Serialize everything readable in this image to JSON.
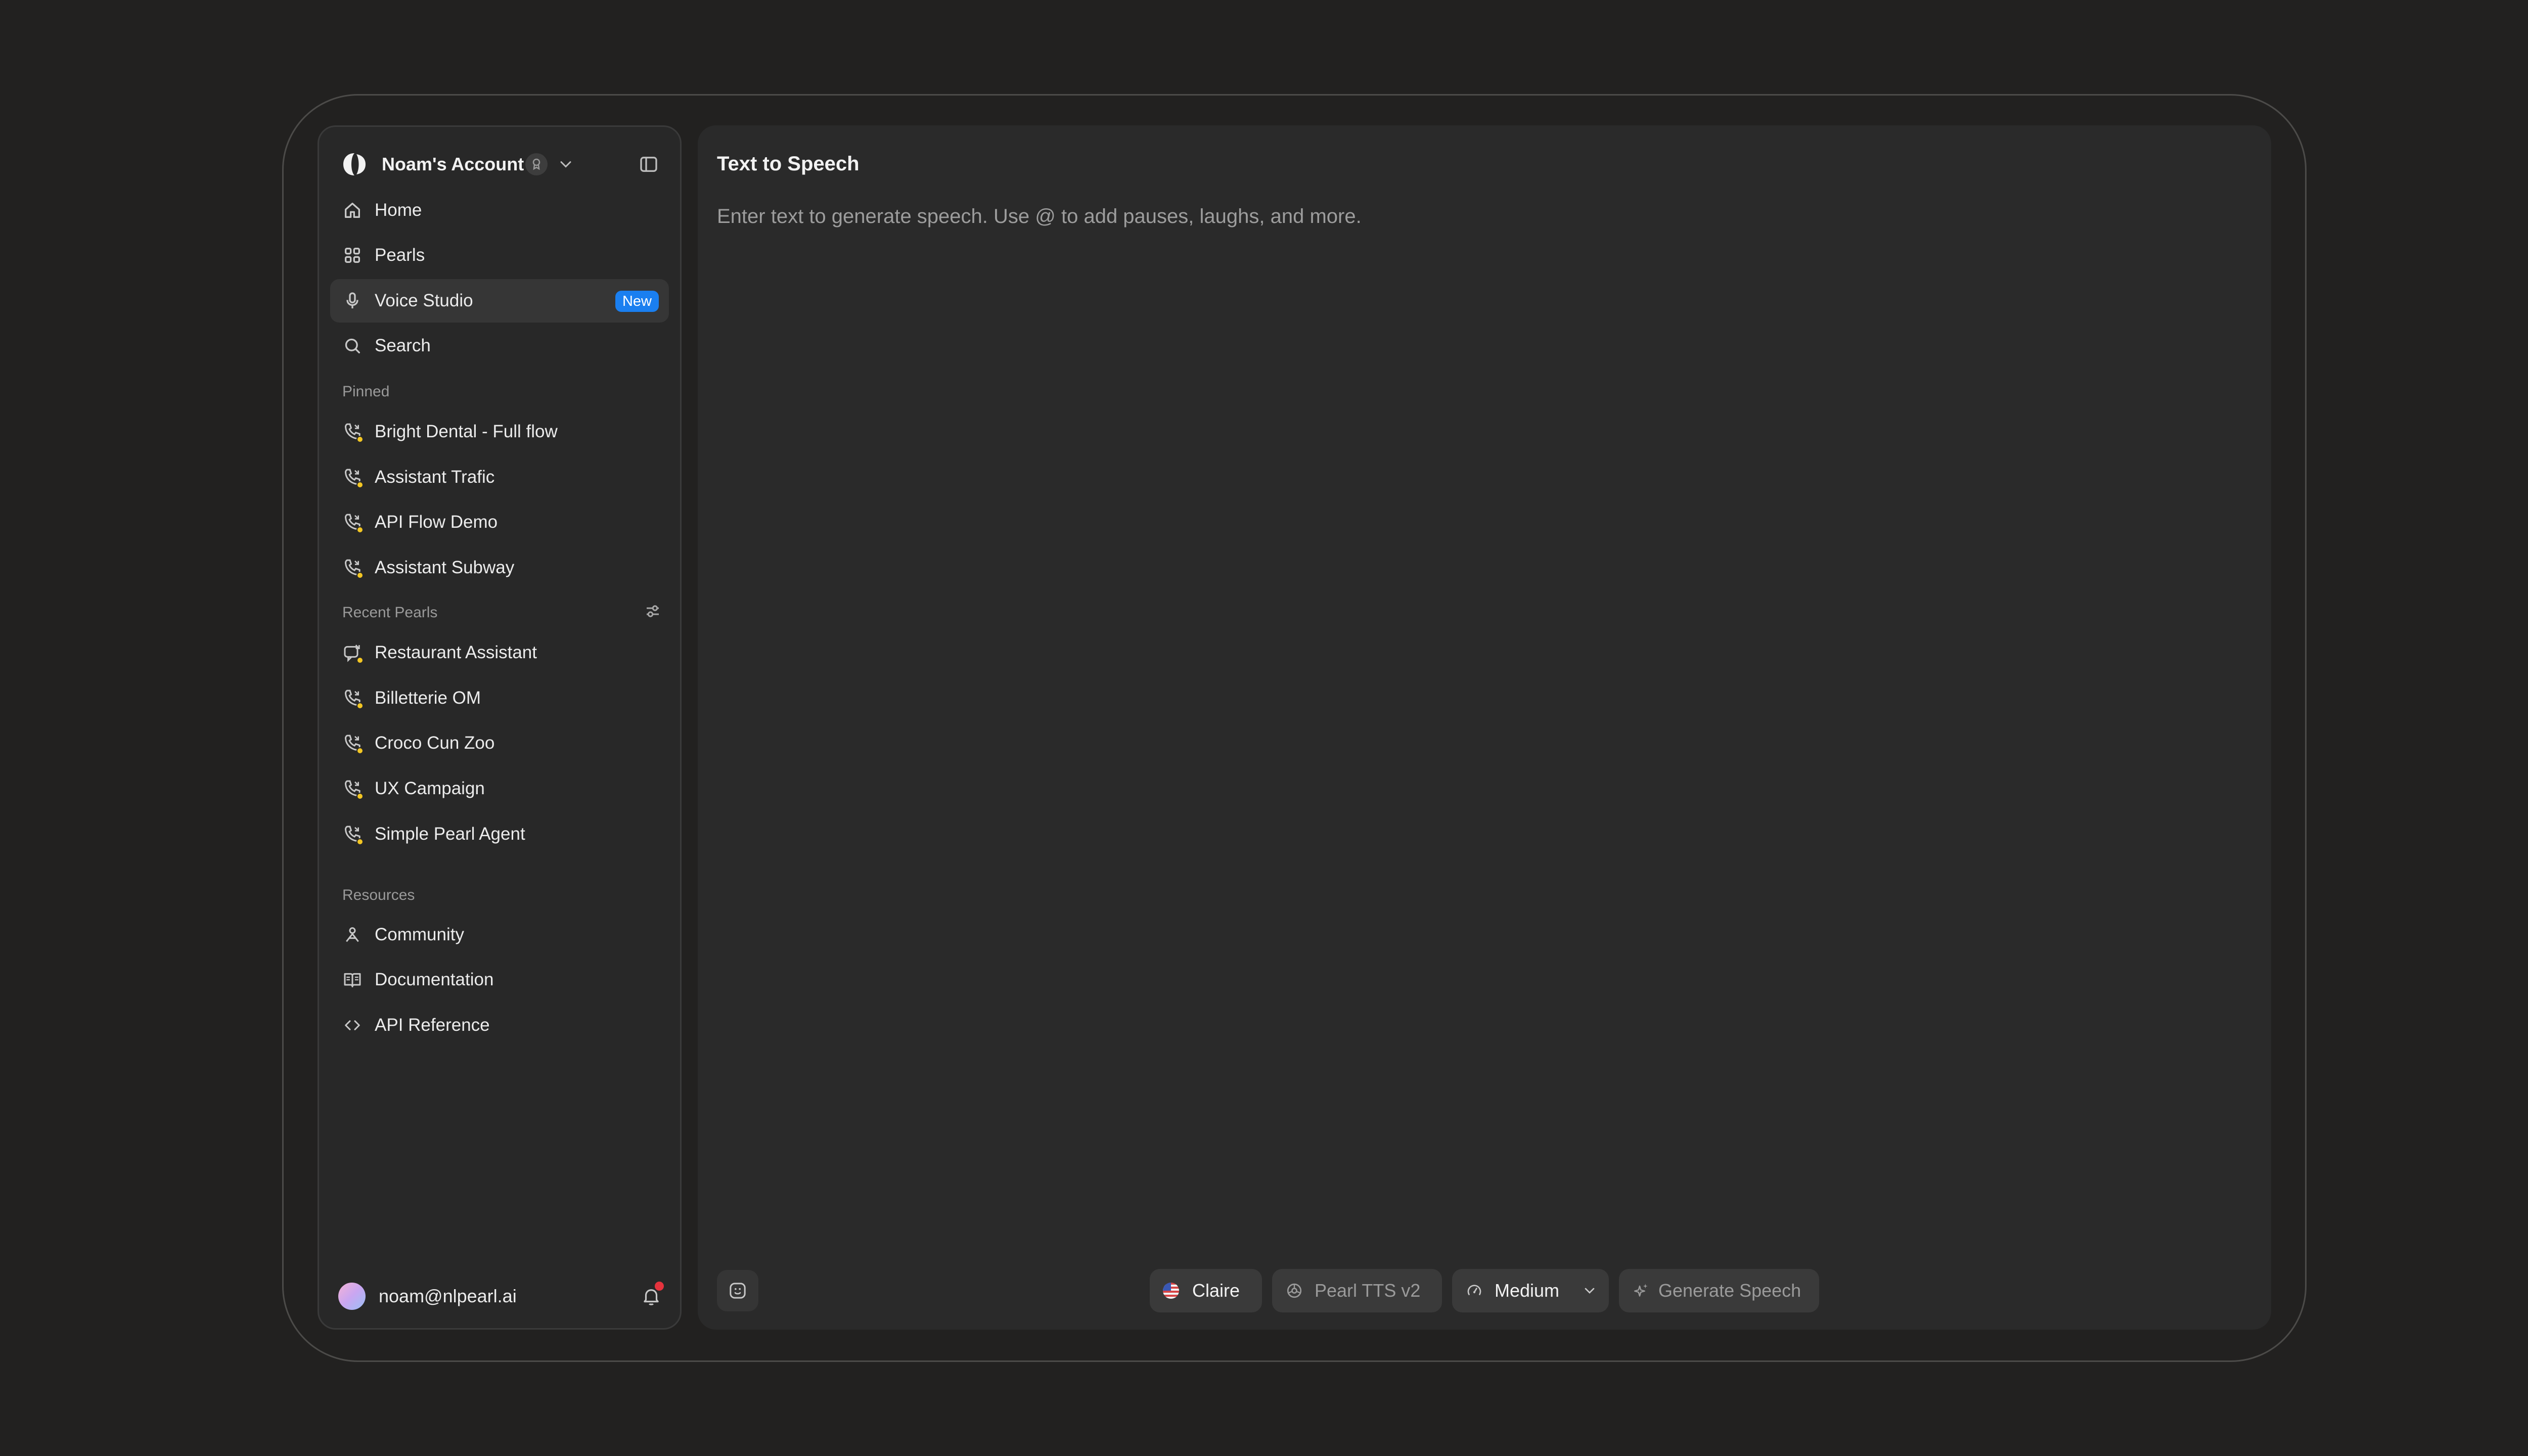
{
  "sidebar": {
    "account_name": "Noam's Account",
    "nav": [
      {
        "label": "Home",
        "icon": "home-icon"
      },
      {
        "label": "Pearls",
        "icon": "grid-icon"
      },
      {
        "label": "Voice Studio",
        "icon": "microphone-icon",
        "badge": "New",
        "active": true
      },
      {
        "label": "Search",
        "icon": "search-icon"
      }
    ],
    "pinned_title": "Pinned",
    "pinned": [
      {
        "label": "Bright Dental - Full flow"
      },
      {
        "label": "Assistant Trafic"
      },
      {
        "label": "API Flow Demo"
      },
      {
        "label": "Assistant Subway"
      }
    ],
    "recent_title": "Recent Pearls",
    "recent": [
      {
        "label": "Restaurant Assistant",
        "icon": "chat-icon"
      },
      {
        "label": "Billetterie OM",
        "icon": "phone-icon"
      },
      {
        "label": "Croco Cun Zoo",
        "icon": "phone-icon"
      },
      {
        "label": "UX Campaign",
        "icon": "phone-icon"
      },
      {
        "label": "Simple Pearl Agent",
        "icon": "phone-icon"
      }
    ],
    "resources_title": "Resources",
    "resources": [
      {
        "label": "Community",
        "icon": "community-icon"
      },
      {
        "label": "Documentation",
        "icon": "book-icon"
      },
      {
        "label": "API Reference",
        "icon": "code-icon"
      }
    ],
    "user_email": "noam@nlpearl.ai"
  },
  "main": {
    "title": "Text to Speech",
    "placeholder": "Enter text to generate speech. Use @ to add pauses, laughs, and more.",
    "voice": "Claire",
    "model": "Pearl TTS v2",
    "speed": "Medium",
    "generate_label": "Generate Speech"
  },
  "colors": {
    "background": "#222120",
    "panel": "#2a2a2a",
    "sidebar": "#282828",
    "accent": "#1a7ff0",
    "status_dot": "#f3c623",
    "notification": "#e5333d"
  }
}
